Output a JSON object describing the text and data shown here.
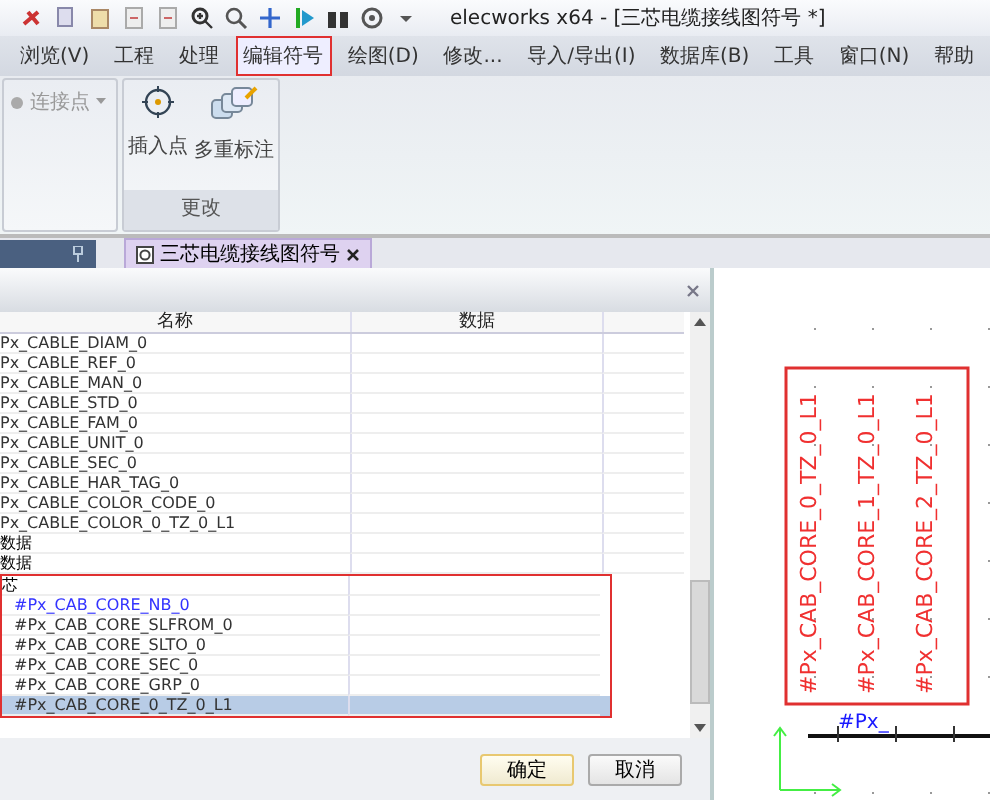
{
  "window": {
    "title": "elecworks x64 - [三芯电缆接线图符号 *]"
  },
  "menu": [
    {
      "label": "浏览(V)",
      "highlighted": false
    },
    {
      "label": "工程",
      "highlighted": false
    },
    {
      "label": "处理",
      "highlighted": false
    },
    {
      "label": "编辑符号",
      "highlighted": true
    },
    {
      "label": "绘图(D)",
      "highlighted": false
    },
    {
      "label": "修改...",
      "highlighted": false
    },
    {
      "label": "导入/导出(I)",
      "highlighted": false
    },
    {
      "label": "数据库(B)",
      "highlighted": false
    },
    {
      "label": "工具",
      "highlighted": false
    },
    {
      "label": "窗口(N)",
      "highlighted": false
    },
    {
      "label": "帮助",
      "highlighted": false
    }
  ],
  "ribbon": {
    "connection_point": {
      "label": "连接点",
      "disabled": true
    },
    "group": {
      "label": "更改",
      "buttons": [
        {
          "label": "插入点",
          "kind": "target"
        },
        {
          "label": "多重标注",
          "kind": "tags"
        }
      ]
    }
  },
  "document_tab": {
    "label": "三芯电缆接线图符号",
    "selected": true
  },
  "table": {
    "columns": [
      "名称",
      "数据"
    ],
    "rows": [
      {
        "name": "Px_CABLE_DIAM_0",
        "color": "#333333"
      },
      {
        "name": "Px_CABLE_REF_0",
        "color": "#333333"
      },
      {
        "name": "Px_CABLE_MAN_0",
        "color": "#333333"
      },
      {
        "name": "Px_CABLE_STD_0",
        "color": "#333333"
      },
      {
        "name": "Px_CABLE_FAM_0",
        "color": "#333333"
      },
      {
        "name": "Px_CABLE_UNIT_0",
        "color": "#333333"
      },
      {
        "name": "Px_CABLE_SEC_0",
        "color": "#333333"
      },
      {
        "name": "Px_CABLE_HAR_TAG_0",
        "color": "#333333"
      },
      {
        "name": "Px_CABLE_COLOR_CODE_0",
        "color": "#333333"
      },
      {
        "name": "Px_CABLE_COLOR_0_TZ_0_L1",
        "color": "#333333"
      },
      {
        "name": "数据",
        "color": "#000000"
      },
      {
        "name": "数据",
        "color": "#000000"
      }
    ],
    "highlighted_rows": [
      {
        "name": "芯",
        "color": "#000000",
        "selected": false
      },
      {
        "name": "#Px_CAB_CORE_NB_0",
        "color": "#3333ff",
        "selected": false
      },
      {
        "name": "#Px_CAB_CORE_SLFROM_0",
        "color": "#333333",
        "selected": false
      },
      {
        "name": "#Px_CAB_CORE_SLTO_0",
        "color": "#333333",
        "selected": false
      },
      {
        "name": "#Px_CAB_CORE_SEC_0",
        "color": "#333333",
        "selected": false
      },
      {
        "name": "#Px_CAB_CORE_GRP_0",
        "color": "#333333",
        "selected": false
      },
      {
        "name": "#Px_CAB_CORE_0_TZ_0_L1",
        "color": "#333333",
        "selected": true
      }
    ]
  },
  "buttons": [
    "确定",
    "取消"
  ],
  "canvas": {
    "symbol_labels": [
      "#Px_CAB_CORE_0_TZ_0_L1",
      "#Px_CAB_CORE_1_TZ_0_L1",
      "#Px_CAB_CORE_2_TZ_0_L1"
    ],
    "attribute_label": "#Px_"
  }
}
